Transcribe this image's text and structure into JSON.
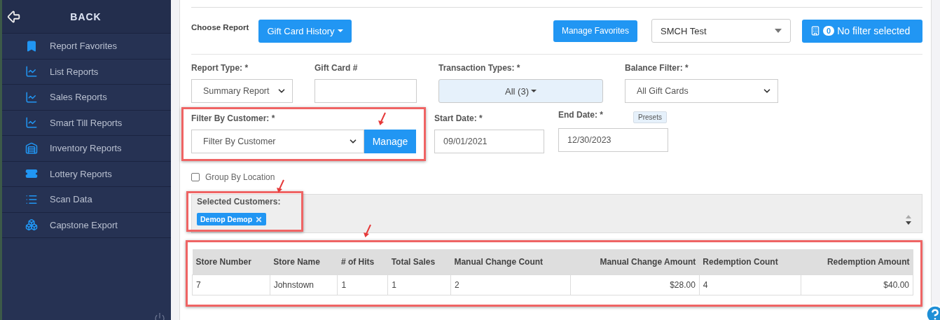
{
  "sidebar": {
    "back_label": "BACK",
    "items": [
      {
        "label": "Report Favorites"
      },
      {
        "label": "List Reports"
      },
      {
        "label": "Sales Reports"
      },
      {
        "label": "Smart Till Reports"
      },
      {
        "label": "Inventory Reports"
      },
      {
        "label": "Lottery Reports"
      },
      {
        "label": "Scan Data"
      },
      {
        "label": "Capstone Export"
      }
    ]
  },
  "toolbar": {
    "choose_label": "Choose Report",
    "report_button": "Gift Card History",
    "favorites_button": "Manage Favorites",
    "store_select": "SMCH Test",
    "filter_count": "0",
    "filter_label": "No filter selected"
  },
  "filters": {
    "report_type": {
      "label": "Report Type: *",
      "value": "Summary Report"
    },
    "gift_card": {
      "label": "Gift Card #"
    },
    "transaction_types": {
      "label": "Transaction Types: *",
      "value": "All (3)"
    },
    "balance_filter": {
      "label": "Balance Filter: *",
      "value": "All Gift Cards"
    },
    "customer": {
      "label": "Filter By Customer: *",
      "value": "Filter By Customer",
      "button": "Manage"
    },
    "start_date": {
      "label": "Start Date: *",
      "value": "09/01/2021"
    },
    "end_date": {
      "label": "End Date: *",
      "value": "12/30/2023",
      "presets": "Presets"
    }
  },
  "group_by_location": {
    "label": "Group By Location",
    "checked": false
  },
  "selected_customers": {
    "label": "Selected Customers:",
    "tags": [
      {
        "label": "Demop Demop"
      }
    ]
  },
  "table": {
    "columns": [
      "Store Number",
      "Store Name",
      "# of Hits",
      "Total Sales",
      "Manual Change Count",
      "Manual Change Amount",
      "Redemption Count",
      "Redemption Amount"
    ],
    "rows": [
      [
        "7",
        "Johnstown",
        "1",
        "1",
        "2",
        "$28.00",
        "4",
        "$40.00"
      ]
    ]
  }
}
